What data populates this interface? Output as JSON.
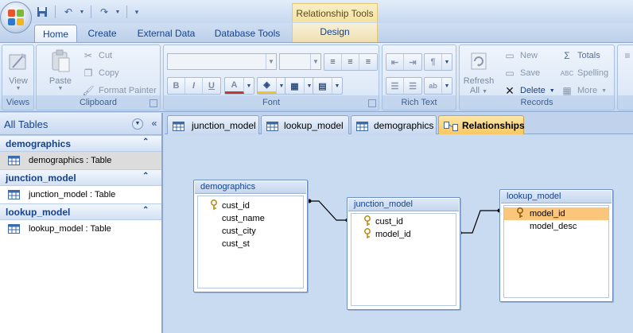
{
  "app": {
    "context_tool": "Relationship Tools"
  },
  "tabs": [
    {
      "label": "Home"
    },
    {
      "label": "Create"
    },
    {
      "label": "External Data"
    },
    {
      "label": "Database Tools"
    },
    {
      "label": "Design"
    }
  ],
  "ribbon": {
    "views": {
      "label": "Views",
      "view_button": "View"
    },
    "clipboard": {
      "label": "Clipboard",
      "paste": "Paste",
      "cut": "Cut",
      "copy": "Copy",
      "format_painter": "Format Painter"
    },
    "font": {
      "label": "Font",
      "font_name": "",
      "font_size": ""
    },
    "rich_text": {
      "label": "Rich Text"
    },
    "records": {
      "label": "Records",
      "refresh": "Refresh",
      "refresh_sub": "All",
      "new": "New",
      "save": "Save",
      "delete": "Delete",
      "totals": "Totals",
      "spelling": "Spelling",
      "more": "More"
    }
  },
  "nav": {
    "title": "All Tables",
    "groups": [
      {
        "name": "demographics",
        "items": [
          {
            "label": "demographics : Table",
            "selected": true
          }
        ]
      },
      {
        "name": "junction_model",
        "items": [
          {
            "label": "junction_model : Table",
            "selected": false
          }
        ]
      },
      {
        "name": "lookup_model",
        "items": [
          {
            "label": "lookup_model : Table",
            "selected": false
          }
        ]
      }
    ]
  },
  "doc_tabs": [
    {
      "label": "junction_model"
    },
    {
      "label": "lookup_model"
    },
    {
      "label": "demographics"
    },
    {
      "label": "Relationships"
    }
  ],
  "relationships": {
    "tables": [
      {
        "name": "demographics",
        "fields": [
          {
            "name": "cust_id",
            "key": true
          },
          {
            "name": "cust_name",
            "key": false
          },
          {
            "name": "cust_city",
            "key": false
          },
          {
            "name": "cust_st",
            "key": false
          }
        ]
      },
      {
        "name": "junction_model",
        "fields": [
          {
            "name": "cust_id",
            "key": true
          },
          {
            "name": "model_id",
            "key": true
          }
        ]
      },
      {
        "name": "lookup_model",
        "fields": [
          {
            "name": "model_id",
            "key": true,
            "highlighted": true
          },
          {
            "name": "model_desc",
            "key": false
          }
        ]
      }
    ]
  }
}
